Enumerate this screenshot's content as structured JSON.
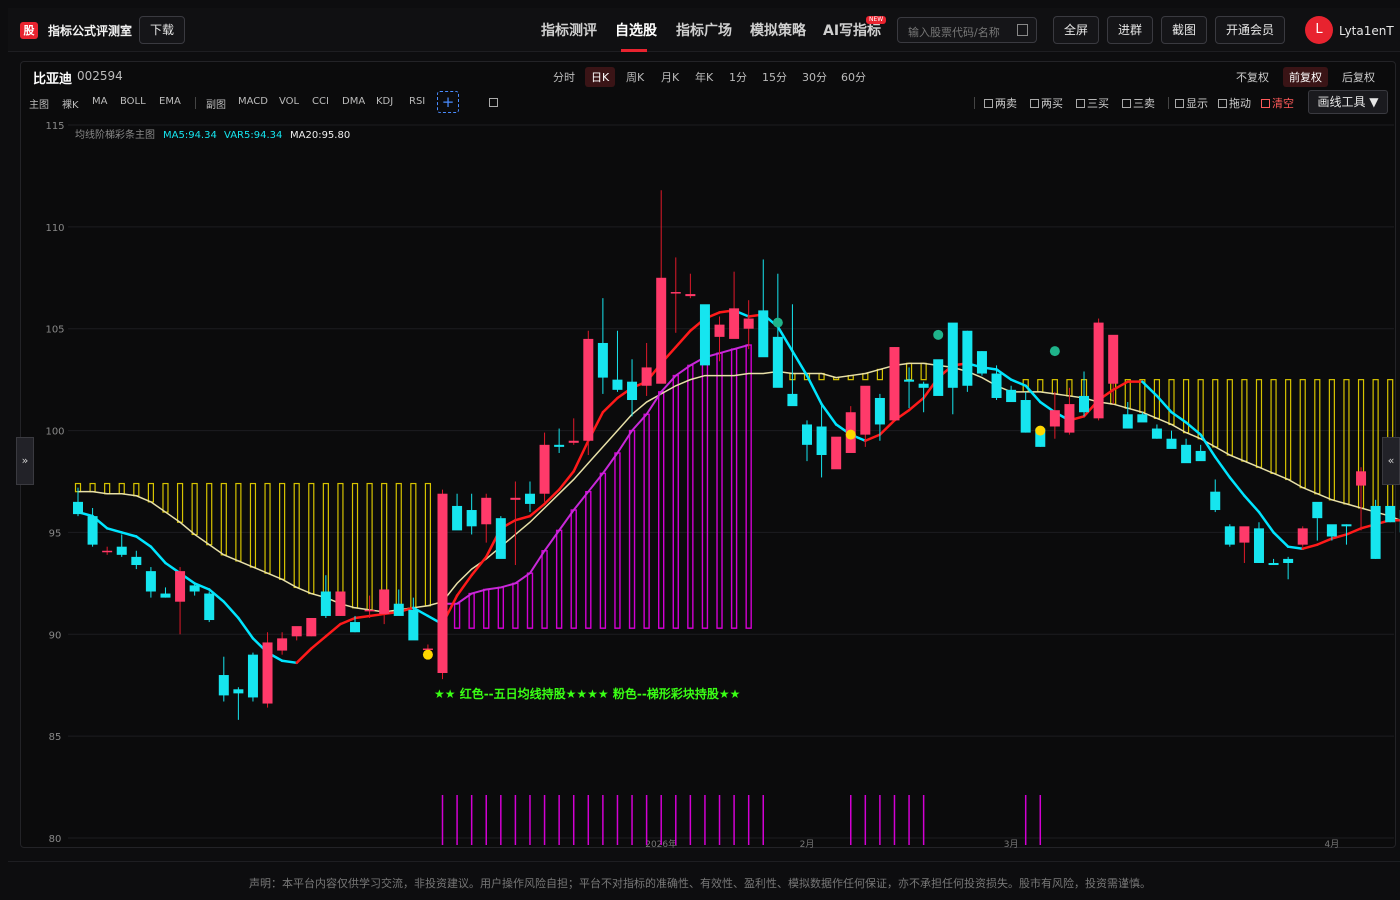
{
  "header": {
    "logo_text": "股",
    "app_title": "指标公式评测室",
    "download_label": "下载",
    "nav": [
      "指标测评",
      "自选股",
      "指标广场",
      "模拟策略",
      "AI写指标"
    ],
    "new_badge": "NEW",
    "search_placeholder": "输入股票代码/名称",
    "buttons": [
      "全屏",
      "进群",
      "截图",
      "开通会员"
    ],
    "avatar_letter": "L",
    "username": "Lyta1enT"
  },
  "stock": {
    "name": "比亚迪",
    "code": "002594"
  },
  "periods": [
    "分时",
    "日K",
    "周K",
    "月K",
    "年K",
    "1分",
    "15分",
    "30分",
    "60分"
  ],
  "active_period": "日K",
  "adjust": [
    "不复权",
    "前复权",
    "后复权"
  ],
  "active_adjust": "前复权",
  "main_indicators": [
    "主图",
    "裸K",
    "MA",
    "BOLL",
    "EMA"
  ],
  "sub_indicators": [
    "副图",
    "MACD",
    "VOL",
    "CCI",
    "DMA",
    "KDJ",
    "RSI"
  ],
  "tools": [
    "两卖",
    "两买",
    "三买",
    "三卖",
    "显示",
    "拖动",
    "清空"
  ],
  "draw_tool": "画线工具",
  "legend": {
    "name": "均线阶梯彩条主图",
    "ma5": "MA5:94.34",
    "var5": "VAR5:94.34",
    "ma20": "MA20:95.80"
  },
  "annotation": "★★ 红色--五日均线持股★★★★ 粉色--梯形彩块持股★★",
  "colors": {
    "up": "#ff3a6a",
    "down": "#16e5ef",
    "ma5_up": "#ff1a1a",
    "ma5_down": "#00e5ff",
    "ma20": "#e8e0a8",
    "bar_magenta": "#d300d3",
    "bar_yellow": "#d6c300",
    "dot_teal": "#1fb38a",
    "dot_yellow": "#ffd700"
  },
  "footer": "声明：本平台内容仅供学习交流，非投资建议。用户操作风险自担；平台不对指标的准确性、有效性、盈利性、模拟数据作任何保证，亦不承担任何投资损失。股市有风险，投资需谨慎。",
  "chart_data": {
    "type": "candlestick",
    "y_ticks": [
      80,
      85,
      90,
      95,
      100,
      105,
      110,
      115
    ],
    "ylim": [
      80,
      115
    ],
    "x_labels": [
      {
        "i": 40,
        "t": "2026年"
      },
      {
        "i": 50,
        "t": "2月"
      },
      {
        "i": 64,
        "t": "3月"
      },
      {
        "i": 86,
        "t": "4月"
      }
    ],
    "candles": [
      [
        96.5,
        97.2,
        95.8,
        95.9
      ],
      [
        95.8,
        96.2,
        94.3,
        94.4
      ],
      [
        94.1,
        94.3,
        93.9,
        94.1
      ],
      [
        94.3,
        94.9,
        93.8,
        93.9
      ],
      [
        93.8,
        94.1,
        93.2,
        93.4
      ],
      [
        93.1,
        93.3,
        91.8,
        92.1
      ],
      [
        92.0,
        92.3,
        91.8,
        91.8
      ],
      [
        91.6,
        93.3,
        90.0,
        93.1
      ],
      [
        92.4,
        92.5,
        91.9,
        92.1
      ],
      [
        92.0,
        92.1,
        90.6,
        90.7
      ],
      [
        88.0,
        88.9,
        86.7,
        87.0
      ],
      [
        87.3,
        87.4,
        85.8,
        87.1
      ],
      [
        89.0,
        89.1,
        86.7,
        86.9
      ],
      [
        86.6,
        90.1,
        86.4,
        89.6
      ],
      [
        89.2,
        90.1,
        89.0,
        89.8
      ],
      [
        89.9,
        90.3,
        89.7,
        90.4
      ],
      [
        89.9,
        90.7,
        89.9,
        90.8
      ],
      [
        92.1,
        92.9,
        90.8,
        90.9
      ],
      [
        90.9,
        92.1,
        90.9,
        92.1
      ],
      [
        90.6,
        90.9,
        90.1,
        90.1
      ],
      [
        91.2,
        91.9,
        90.8,
        91.2
      ],
      [
        91.0,
        92.2,
        90.5,
        92.2
      ],
      [
        91.5,
        92.2,
        91.3,
        90.9
      ],
      [
        91.2,
        91.8,
        90.0,
        89.7
      ],
      [
        89.3,
        89.5,
        89.2,
        89.3
      ],
      [
        88.1,
        97.1,
        87.8,
        96.9
      ],
      [
        96.3,
        96.9,
        95.2,
        95.1
      ],
      [
        96.1,
        96.9,
        94.9,
        95.3
      ],
      [
        95.4,
        96.9,
        94.5,
        96.7
      ],
      [
        95.7,
        95.8,
        93.9,
        93.7
      ],
      [
        96.6,
        97.5,
        93.4,
        96.7
      ],
      [
        96.9,
        97.5,
        96.0,
        96.4
      ],
      [
        96.9,
        99.9,
        96.5,
        99.3
      ],
      [
        99.3,
        100.1,
        98.9,
        99.2
      ],
      [
        99.4,
        100.6,
        99.3,
        99.5
      ],
      [
        99.5,
        104.9,
        98.8,
        104.5
      ],
      [
        104.3,
        106.5,
        101.8,
        102.6
      ],
      [
        102.5,
        104.9,
        101.9,
        102.0
      ],
      [
        102.4,
        103.5,
        100.7,
        101.5
      ],
      [
        102.2,
        104.3,
        101.7,
        103.1
      ],
      [
        102.3,
        111.8,
        102.9,
        107.5
      ],
      [
        106.8,
        108.5,
        104.8,
        106.8
      ],
      [
        106.6,
        107.7,
        106.5,
        106.7
      ],
      [
        106.2,
        105.4,
        103.3,
        103.2
      ],
      [
        104.6,
        105.6,
        103.4,
        105.2
      ],
      [
        104.5,
        107.8,
        104.6,
        106.0
      ],
      [
        105.0,
        106.4,
        104.0,
        105.5
      ],
      [
        105.9,
        108.4,
        104.0,
        103.6
      ],
      [
        104.6,
        107.7,
        102.5,
        102.1
      ],
      [
        101.8,
        106.2,
        101.6,
        101.2
      ],
      [
        100.3,
        100.5,
        98.5,
        99.3
      ],
      [
        100.2,
        101.3,
        97.7,
        98.8
      ],
      [
        98.1,
        99.6,
        98.3,
        99.7
      ],
      [
        98.9,
        101.2,
        99.0,
        100.9
      ],
      [
        99.8,
        102.1,
        99.2,
        102.2
      ],
      [
        101.6,
        101.8,
        99.5,
        100.3
      ],
      [
        100.5,
        104.1,
        101.0,
        104.1
      ],
      [
        102.5,
        103.1,
        101.1,
        102.4
      ],
      [
        102.3,
        102.4,
        100.9,
        102.1
      ],
      [
        103.5,
        103.2,
        101.8,
        101.7
      ],
      [
        105.3,
        103.4,
        100.8,
        102.1
      ],
      [
        104.9,
        104.9,
        101.9,
        102.2
      ],
      [
        103.9,
        103.9,
        102.7,
        102.8
      ],
      [
        102.8,
        103.2,
        101.5,
        101.6
      ],
      [
        102.0,
        102.2,
        101.6,
        101.4
      ],
      [
        101.5,
        101.9,
        99.9,
        99.9
      ],
      [
        100.1,
        100.0,
        99.2,
        99.2
      ],
      [
        100.2,
        101.9,
        99.6,
        101.0
      ],
      [
        99.9,
        102.1,
        99.8,
        101.3
      ],
      [
        101.7,
        102.9,
        100.7,
        100.9
      ],
      [
        100.6,
        105.5,
        100.5,
        105.3
      ],
      [
        102.3,
        103.1,
        101.3,
        104.7
      ],
      [
        100.8,
        101.4,
        100.1,
        100.1
      ],
      [
        100.8,
        100.9,
        100.5,
        100.4
      ],
      [
        100.1,
        100.3,
        99.6,
        99.6
      ],
      [
        99.6,
        100.0,
        99.2,
        99.1
      ],
      [
        99.3,
        99.6,
        98.9,
        98.4
      ],
      [
        99.0,
        99.3,
        98.6,
        98.5
      ],
      [
        97.0,
        97.6,
        96.0,
        96.1
      ],
      [
        95.3,
        95.4,
        94.3,
        94.4
      ],
      [
        94.5,
        94.8,
        93.5,
        95.3
      ],
      [
        95.2,
        95.5,
        93.5,
        93.5
      ],
      [
        93.5,
        93.7,
        93.4,
        93.4
      ],
      [
        93.7,
        93.8,
        92.7,
        93.5
      ],
      [
        94.4,
        95.3,
        94.3,
        95.2
      ],
      [
        96.5,
        95.7,
        94.6,
        95.7
      ],
      [
        95.4,
        95.2,
        94.6,
        94.8
      ],
      [
        95.4,
        95.4,
        94.4,
        95.3
      ],
      [
        97.3,
        98.2,
        95.1,
        98.0
      ],
      [
        96.3,
        96.6,
        93.7,
        93.7
      ],
      [
        96.3,
        96.3,
        95.5,
        95.5
      ],
      [
        96.1,
        96.2,
        94.8,
        95.0
      ],
      [
        93.3,
        93.4,
        93.0,
        93.6
      ],
      [
        93.3,
        93.9,
        92.6,
        92.8
      ]
    ],
    "ma5": [
      96.0,
      95.8,
      95.2,
      95.0,
      94.8,
      94.3,
      93.5,
      93.0,
      92.5,
      92.2,
      91.6,
      90.8,
      89.8,
      89.1,
      88.7,
      88.6,
      89.3,
      89.9,
      90.5,
      90.8,
      90.9,
      91.0,
      91.1,
      91.3,
      90.9,
      90.5,
      91.9,
      92.9,
      93.8,
      95.2,
      95.6,
      95.8,
      96.4,
      97.1,
      98.0,
      99.5,
      100.9,
      101.6,
      102.1,
      102.4,
      103.3,
      104.1,
      104.9,
      105.5,
      105.8,
      105.9,
      105.6,
      105.7,
      105.1,
      103.9,
      102.7,
      101.3,
      100.3,
      99.8,
      99.5,
      99.8,
      100.5,
      101.0,
      101.6,
      102.6,
      103.2,
      103.3,
      103.1,
      103.0,
      102.5,
      102.2,
      101.4,
      100.9,
      100.5,
      100.7,
      101.5,
      102.0,
      102.4,
      102.4,
      101.7,
      100.9,
      100.4,
      99.8,
      98.7,
      97.7,
      96.8,
      96.0,
      95.0,
      94.3,
      94.2,
      94.4,
      94.7,
      94.9,
      95.2,
      95.4,
      95.6,
      95.6,
      95.5,
      95.0,
      94.3
    ],
    "ma20": [
      97.0,
      97.0,
      96.9,
      96.9,
      96.8,
      96.5,
      96.0,
      95.5,
      94.9,
      94.4,
      93.9,
      93.6,
      93.3,
      93.0,
      92.7,
      92.3,
      92.0,
      91.8,
      91.5,
      91.3,
      91.2,
      91.1,
      91.2,
      91.3,
      91.4,
      91.6,
      92.5,
      93.2,
      93.7,
      94.3,
      94.9,
      95.5,
      96.2,
      96.9,
      97.6,
      98.4,
      99.2,
      100.0,
      100.8,
      101.4,
      101.8,
      102.2,
      102.5,
      102.7,
      102.7,
      102.7,
      102.8,
      102.8,
      102.9,
      102.8,
      102.8,
      102.8,
      102.6,
      102.7,
      102.8,
      103.0,
      103.2,
      103.3,
      103.3,
      103.2,
      103.1,
      102.9,
      102.6,
      102.2,
      101.9,
      101.9,
      101.9,
      101.8,
      101.7,
      101.6,
      101.4,
      101.3,
      101.1,
      100.9,
      100.6,
      100.3,
      99.9,
      99.6,
      99.2,
      98.8,
      98.5,
      98.2,
      97.9,
      97.6,
      97.2,
      96.9,
      96.6,
      96.4,
      96.2,
      96.0,
      95.8,
      95.5,
      95.3,
      95.8,
      95.8
    ],
    "purple_line": [
      91.5,
      91.5,
      92.0,
      92.2,
      92.3,
      92.5,
      93.0,
      94.1,
      95.1,
      96.1,
      97.0,
      97.9,
      98.9,
      100.0,
      100.8,
      101.9,
      102.7,
      103.2,
      103.6,
      103.8,
      104.0,
      104.2
    ],
    "ladder_bars": {
      "yellow_ranges": [
        [
          0,
          24
        ],
        [
          48,
          58
        ],
        [
          65,
          95
        ]
      ],
      "yellow_top": [
        97.4,
        97.4,
        97.4,
        97.4,
        97.4,
        97.4,
        97.4,
        97.4,
        97.4,
        97.4,
        97.4,
        97.4,
        97.4,
        97.4,
        97.4,
        97.4,
        97.4,
        97.4,
        97.4,
        97.4,
        97.4,
        97.4,
        97.4,
        97.4,
        97.4
      ],
      "magenta_range": [
        25,
        47
      ]
    },
    "dots": [
      {
        "i": 48,
        "y": 105.3,
        "c": "teal"
      },
      {
        "i": 59,
        "y": 104.7,
        "c": "teal"
      },
      {
        "i": 67,
        "y": 103.9,
        "c": "teal"
      },
      {
        "i": 53,
        "y": 99.8,
        "c": "yellow"
      },
      {
        "i": 66,
        "y": 100.0,
        "c": "yellow"
      },
      {
        "i": 24,
        "y": 89.0,
        "c": "yellow"
      }
    ],
    "signal_marks": [
      [
        25,
        47
      ],
      [
        53,
        58
      ],
      [
        65,
        66
      ]
    ]
  }
}
